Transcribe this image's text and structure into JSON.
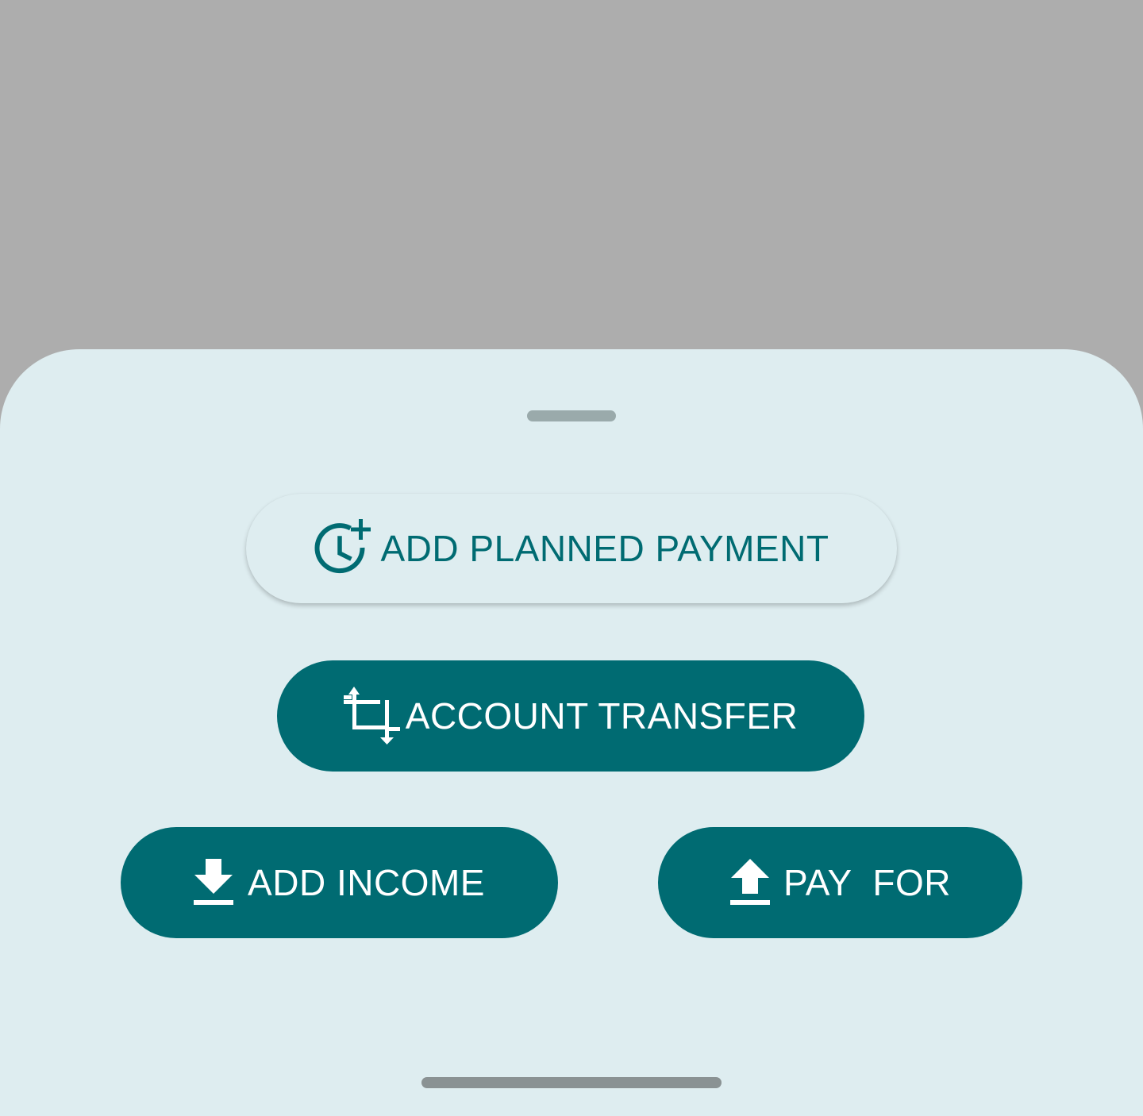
{
  "sheet": {
    "background_color": "#deedf0",
    "accent_color": "#006b72",
    "scrim_color": "#adadad"
  },
  "actions": {
    "planned_payment": {
      "label": "ADD PLANNED PAYMENT",
      "icon": "schedule-add-icon"
    },
    "account_transfer": {
      "label": "ACCOUNT TRANSFER",
      "icon": "transfer-crop-icon"
    },
    "add_income": {
      "label": "ADD INCOME",
      "icon": "download-icon"
    },
    "pay_for": {
      "label": "PAY  FOR",
      "icon": "upload-icon"
    }
  }
}
